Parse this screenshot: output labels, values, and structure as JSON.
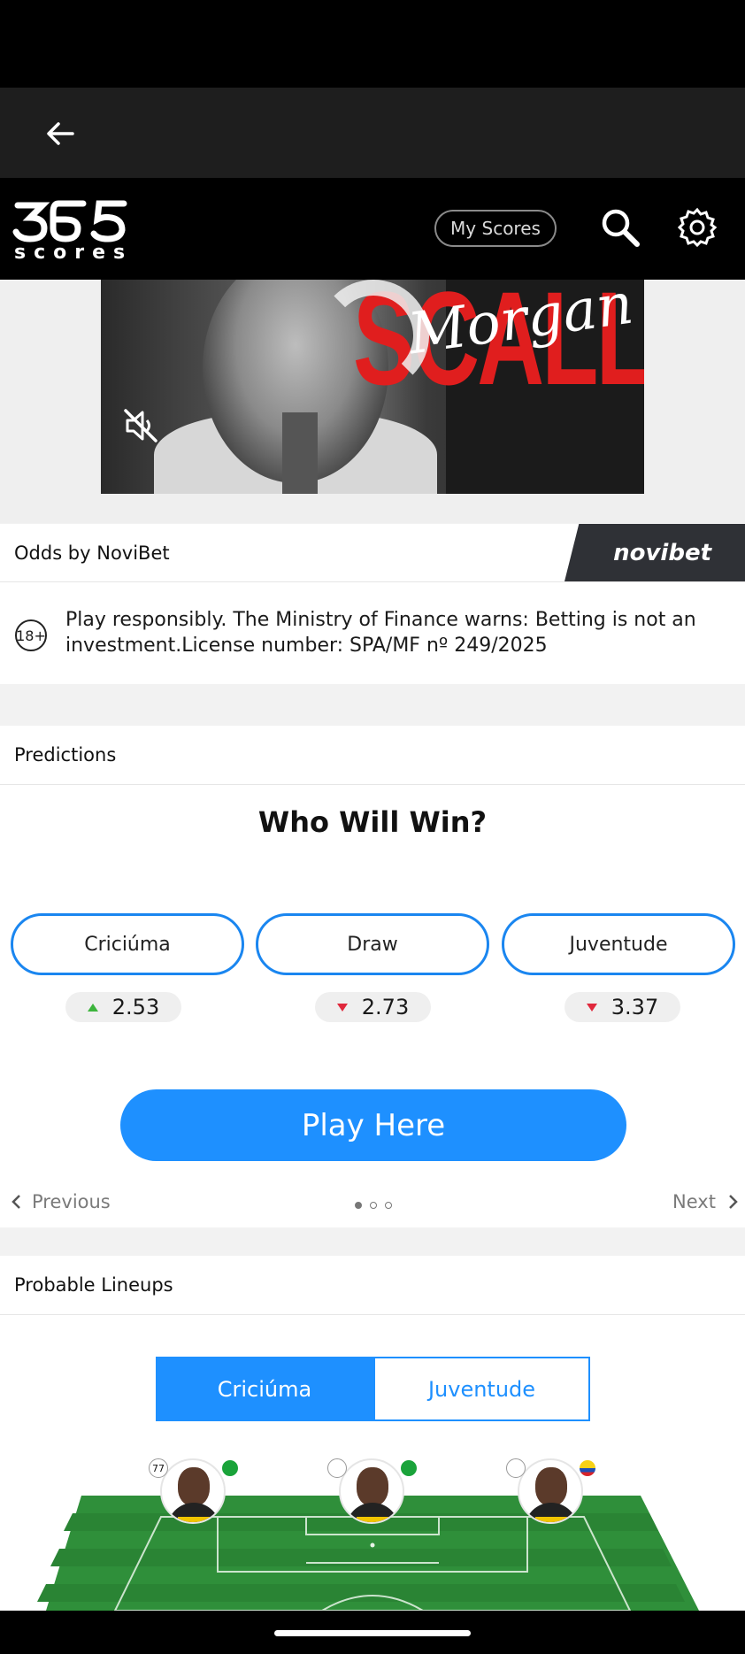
{
  "header": {
    "logo_text": "365",
    "logo_sub": "scores",
    "my_scores_label": "My Scores"
  },
  "video": {
    "overlay_word": "SCALLEY",
    "overlay_script": "Morgan"
  },
  "odds": {
    "header_label": "Odds by NoviBet",
    "brand": "novibet",
    "age_label": "18+",
    "disclaimer": "Play responsibly. The Ministry of Finance warns: Betting is not an investment.License number: SPA/MF nº 249/2025"
  },
  "predictions": {
    "header_label": "Predictions",
    "title": "Who Will Win?",
    "options": [
      {
        "label": "Criciúma",
        "odd": "2.53",
        "trend": "up"
      },
      {
        "label": "Draw",
        "odd": "2.73",
        "trend": "down"
      },
      {
        "label": "Juventude",
        "odd": "3.37",
        "trend": "down"
      }
    ],
    "play_label": "Play Here",
    "prev_label": "Previous",
    "next_label": "Next",
    "page_dots": 3,
    "active_dot": 1
  },
  "lineups": {
    "header_label": "Probable Lineups",
    "tabs": [
      "Criciúma",
      "Juventude"
    ],
    "active_tab": "Criciúma",
    "players": [
      {
        "number": "77"
      },
      {
        "number": ""
      },
      {
        "number": ""
      }
    ]
  },
  "colors": {
    "accent": "#1e90ff",
    "up": "#3cb43c",
    "down": "#e0283c",
    "pitch": "#2f8f3a"
  }
}
